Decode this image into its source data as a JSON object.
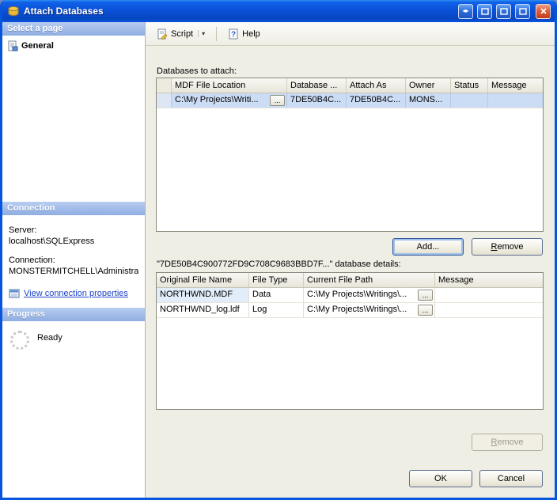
{
  "window": {
    "title": "Attach Databases",
    "controls": {
      "arrows": "◂▸"
    }
  },
  "sidebar": {
    "pages": {
      "header": "Select a page",
      "items": [
        {
          "label": "General"
        }
      ]
    },
    "connection": {
      "header": "Connection",
      "server_label": "Server:",
      "server_value": "localhost\\SQLExpress",
      "connection_label": "Connection:",
      "connection_value": "MONSTERMITCHELL\\Administra",
      "link_label": "View connection properties"
    },
    "progress": {
      "header": "Progress",
      "status": "Ready"
    }
  },
  "toolbar": {
    "script": "Script",
    "script_arrow": "▾",
    "help": "Help"
  },
  "main": {
    "attach_section_label": "Databases to attach:",
    "attach_grid": {
      "columns": [
        "MDF File Location",
        "Database ...",
        "Attach As",
        "Owner",
        "Status",
        "Message"
      ],
      "rows": [
        {
          "mdf_file_location": "C:\\My Projects\\Writi...",
          "browse": "...",
          "database": "7DE50B4C...",
          "attach_as": "7DE50B4C...",
          "owner": "MONS...",
          "status": "",
          "message": ""
        }
      ]
    },
    "add_button": "Add...",
    "remove_button": "Remove",
    "details_section_label": "\"7DE50B4C900772FD9C708C9683BBD7F...\" database details:",
    "details_grid": {
      "columns": [
        "Original File Name",
        "File Type",
        "Current File Path",
        "Message"
      ],
      "rows": [
        {
          "original_file_name": "NORTHWND.MDF",
          "file_type": "Data",
          "current_file_path": "C:\\My Projects\\Writings\\...",
          "browse": "...",
          "message": ""
        },
        {
          "original_file_name": "NORTHWND_log.ldf",
          "file_type": "Log",
          "current_file_path": "C:\\My Projects\\Writings\\...",
          "browse": "...",
          "message": ""
        }
      ]
    },
    "details_remove_button": "Remove",
    "ok_button": "OK",
    "cancel_button": "Cancel"
  }
}
